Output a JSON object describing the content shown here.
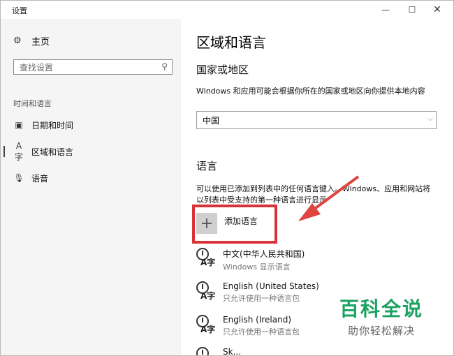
{
  "window": {
    "title": "设置",
    "minimize": "—",
    "maximize": "☐",
    "close": "✕"
  },
  "sidebar": {
    "home_icon": "gear-icon",
    "home_label": "主页",
    "search_placeholder": "查找设置",
    "section_title": "时间和语言",
    "items": [
      {
        "label": "日期和时间",
        "icon": "calendar-clock-icon"
      },
      {
        "label": "区域和语言",
        "icon": "region-language-icon",
        "active": true
      },
      {
        "label": "语音",
        "icon": "microphone-icon"
      }
    ]
  },
  "main": {
    "title": "区域和语言",
    "country_heading": "国家或地区",
    "country_desc": "Windows 和应用可能会根据你所在的国家或地区向你提供本地内容",
    "country_value": "中国",
    "language_heading": "语言",
    "language_desc": "可以使用已添加到列表中的任何语言键入。Windows、应用和网站将以列表中受支持的第一种语言进行显示",
    "add_language_label": "添加语言",
    "languages": [
      {
        "name": "中文(中华人民共和国)",
        "detail": "Windows 显示语言"
      },
      {
        "name": "English (United States)",
        "detail": "只允许使用一种语言包"
      },
      {
        "name": "English (Ireland)",
        "detail": "只允许使用一种语言包"
      },
      {
        "name": "Sk...",
        "detail": ""
      }
    ]
  },
  "watermark": {
    "title": "百科全说",
    "subtitle": "助你轻松解决"
  },
  "colors": {
    "highlight_border": "#d9333a",
    "watermark_green": "#1aa260"
  }
}
